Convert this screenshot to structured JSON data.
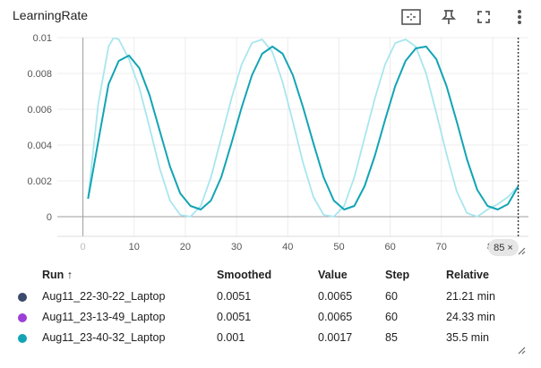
{
  "header": {
    "title": "LearningRate",
    "icons": [
      "fit-domain-icon",
      "pin-icon",
      "fullscreen-icon",
      "more-vert-icon"
    ]
  },
  "chart_data": {
    "type": "line",
    "xlim": [
      -5,
      87
    ],
    "ylim": [
      -0.0011,
      0.01
    ],
    "x_ticks": [
      0,
      10,
      20,
      30,
      40,
      50,
      60,
      70,
      80
    ],
    "y_ticks": [
      0,
      0.002,
      0.004,
      0.006,
      0.008,
      0.01
    ],
    "y_tick_labels": [
      "0",
      "0.002",
      "0.004",
      "0.006",
      "0.008",
      "0.01"
    ],
    "x_tick_labels": [
      "0",
      "10",
      "20",
      "30",
      "40",
      "50",
      "60",
      "70",
      "80"
    ],
    "grid": true,
    "cursor_step": 85,
    "cursor_label": "85 ×",
    "series": [
      {
        "color": "#12a4b4",
        "values": [
          [
            1,
            0.001
          ],
          [
            3,
            0.0042
          ],
          [
            5,
            0.0074
          ],
          [
            7,
            0.0087
          ],
          [
            9,
            0.009
          ],
          [
            11,
            0.0083
          ],
          [
            13,
            0.0068
          ],
          [
            15,
            0.0048
          ],
          [
            17,
            0.0028
          ],
          [
            19,
            0.0013
          ],
          [
            21,
            0.0006
          ],
          [
            23,
            0.0004
          ],
          [
            25,
            0.0009
          ],
          [
            27,
            0.0022
          ],
          [
            29,
            0.0041
          ],
          [
            31,
            0.0061
          ],
          [
            33,
            0.0079
          ],
          [
            35,
            0.0091
          ],
          [
            37,
            0.0095
          ],
          [
            39,
            0.0091
          ],
          [
            41,
            0.0079
          ],
          [
            43,
            0.0061
          ],
          [
            45,
            0.0041
          ],
          [
            47,
            0.0022
          ],
          [
            49,
            0.0009
          ],
          [
            51,
            0.0004
          ],
          [
            53,
            0.0006
          ],
          [
            55,
            0.0017
          ],
          [
            57,
            0.0034
          ],
          [
            59,
            0.0054
          ],
          [
            61,
            0.0073
          ],
          [
            63,
            0.0087
          ],
          [
            65,
            0.0094
          ],
          [
            67,
            0.0095
          ],
          [
            69,
            0.0088
          ],
          [
            71,
            0.0073
          ],
          [
            73,
            0.0053
          ],
          [
            75,
            0.0032
          ],
          [
            77,
            0.0015
          ],
          [
            79,
            0.0006
          ],
          [
            81,
            0.0004
          ],
          [
            83,
            0.0007
          ],
          [
            85,
            0.0017
          ]
        ]
      },
      {
        "color": "#a8e6ee",
        "values": [
          [
            1,
            0.001
          ],
          [
            3,
            0.0063
          ],
          [
            5,
            0.0095
          ],
          [
            6,
            0.01
          ],
          [
            7,
            0.0099
          ],
          [
            9,
            0.0088
          ],
          [
            11,
            0.0072
          ],
          [
            13,
            0.005
          ],
          [
            15,
            0.0027
          ],
          [
            17,
            0.0009
          ],
          [
            19,
            0.0001
          ],
          [
            21,
            0.0
          ],
          [
            23,
            0.0006
          ],
          [
            25,
            0.0022
          ],
          [
            27,
            0.0044
          ],
          [
            29,
            0.0066
          ],
          [
            31,
            0.0085
          ],
          [
            33,
            0.0097
          ],
          [
            35,
            0.0099
          ],
          [
            37,
            0.0092
          ],
          [
            39,
            0.0075
          ],
          [
            41,
            0.0053
          ],
          [
            43,
            0.003
          ],
          [
            45,
            0.0011
          ],
          [
            47,
            0.0001
          ],
          [
            49,
            0.0
          ],
          [
            51,
            0.0006
          ],
          [
            53,
            0.0022
          ],
          [
            55,
            0.0044
          ],
          [
            57,
            0.0066
          ],
          [
            59,
            0.0085
          ],
          [
            61,
            0.0097
          ],
          [
            63,
            0.0099
          ],
          [
            65,
            0.0095
          ],
          [
            67,
            0.008
          ],
          [
            69,
            0.0058
          ],
          [
            71,
            0.0035
          ],
          [
            73,
            0.0014
          ],
          [
            75,
            0.0002
          ],
          [
            77,
            0.0
          ],
          [
            79,
            0.0004
          ],
          [
            81,
            0.0007
          ],
          [
            83,
            0.0011
          ],
          [
            85,
            0.0017
          ]
        ]
      }
    ]
  },
  "table": {
    "columns": [
      "Run ↑",
      "Smoothed",
      "Value",
      "Step",
      "Relative"
    ],
    "rows": [
      {
        "color": "#3b4a6b",
        "run": "Aug11_22-30-22_Laptop",
        "smoothed": "0.0051",
        "value": "0.0065",
        "step": "60",
        "relative": "21.21 min"
      },
      {
        "color": "#9c3fd6",
        "run": "Aug11_23-13-49_Laptop",
        "smoothed": "0.0051",
        "value": "0.0065",
        "step": "60",
        "relative": "24.33 min"
      },
      {
        "color": "#12a4b4",
        "run": "Aug11_23-40-32_Laptop",
        "smoothed": "0.001",
        "value": "0.0017",
        "step": "85",
        "relative": "35.5 min"
      }
    ]
  }
}
